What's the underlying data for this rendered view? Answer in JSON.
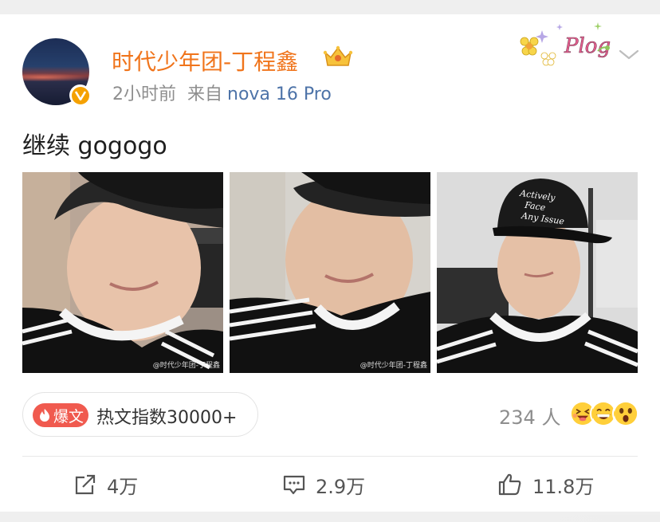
{
  "post": {
    "author": "时代少年团-丁程鑫",
    "time": "2小时前",
    "source_prefix": "来自",
    "device": "nova 16 Pro",
    "text": "继续 gogogo",
    "sticker_text": "Plog",
    "photos": [
      {
        "watermark": "@时代少年团-丁程鑫"
      },
      {
        "watermark": "@时代少年团-丁程鑫"
      },
      {
        "watermark": ""
      }
    ],
    "hot_badge": "爆文",
    "hot_index": "热文指数30000+",
    "reaction_count": "234 人",
    "reaction_icons": [
      "laugh-squint-icon",
      "grin-icon",
      "surprised-icon"
    ],
    "actions": {
      "repost": "4万",
      "comment": "2.9万",
      "like": "11.8万"
    }
  },
  "colors": {
    "author": "#f0741b",
    "device": "#4d73a8",
    "hot_badge": "#f05a4f",
    "muted": "#8e8e8e",
    "verified_badge": "#f5a100"
  }
}
